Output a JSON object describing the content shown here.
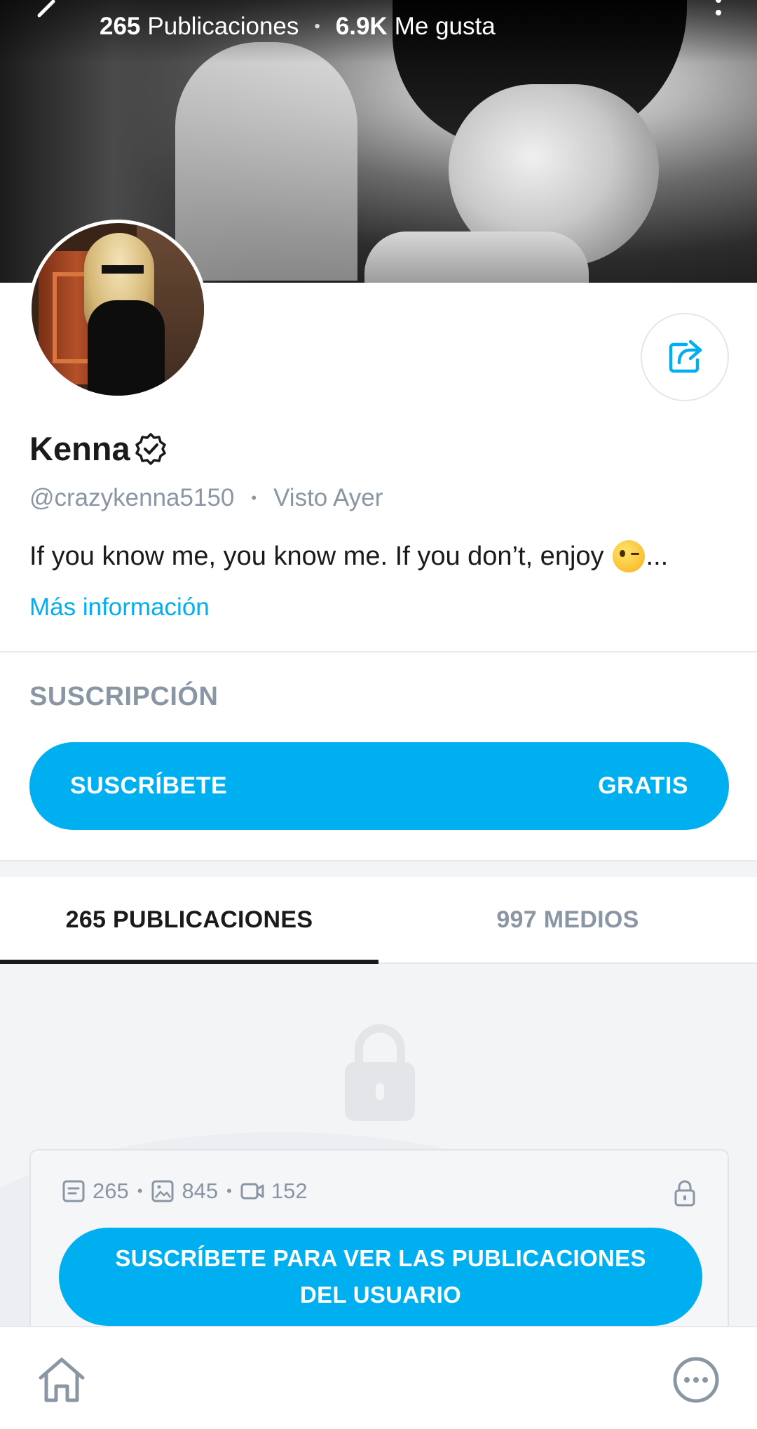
{
  "header": {
    "posts_count": "265",
    "posts_label": "Publicaciones",
    "likes_count": "6.9K",
    "likes_label": "Me gusta",
    "separator": "•"
  },
  "profile": {
    "name": "Kenna",
    "handle": "@crazykenna5150",
    "last_seen": "Visto Ayer",
    "bio": "If you know me, you know me. If you don’t, enjoy",
    "bio_ellipsis": "...",
    "more_info": "Más información"
  },
  "subscription": {
    "title": "SUSCRIPCIÓN",
    "button_label": "SUSCRÍBETE",
    "price_label": "GRATIS"
  },
  "tabs": [
    {
      "label": "265 PUBLICACIONES",
      "active": true
    },
    {
      "label": "997 MEDIOS",
      "active": false
    }
  ],
  "locked_card": {
    "posts": "265",
    "photos": "845",
    "videos": "152",
    "button_line1": "SUSCRÍBETE PARA VER LAS PUBLICACIONES",
    "button_line2": "DEL USUARIO"
  },
  "colors": {
    "accent": "#00aff0",
    "muted": "#8a96a3",
    "text": "#1a1a1a"
  },
  "icons": [
    "back-arrow-icon",
    "more-vertical-icon",
    "share-icon",
    "verified-icon",
    "lock-icon",
    "post-icon",
    "photo-icon",
    "video-icon",
    "home-icon",
    "chat-icon"
  ]
}
